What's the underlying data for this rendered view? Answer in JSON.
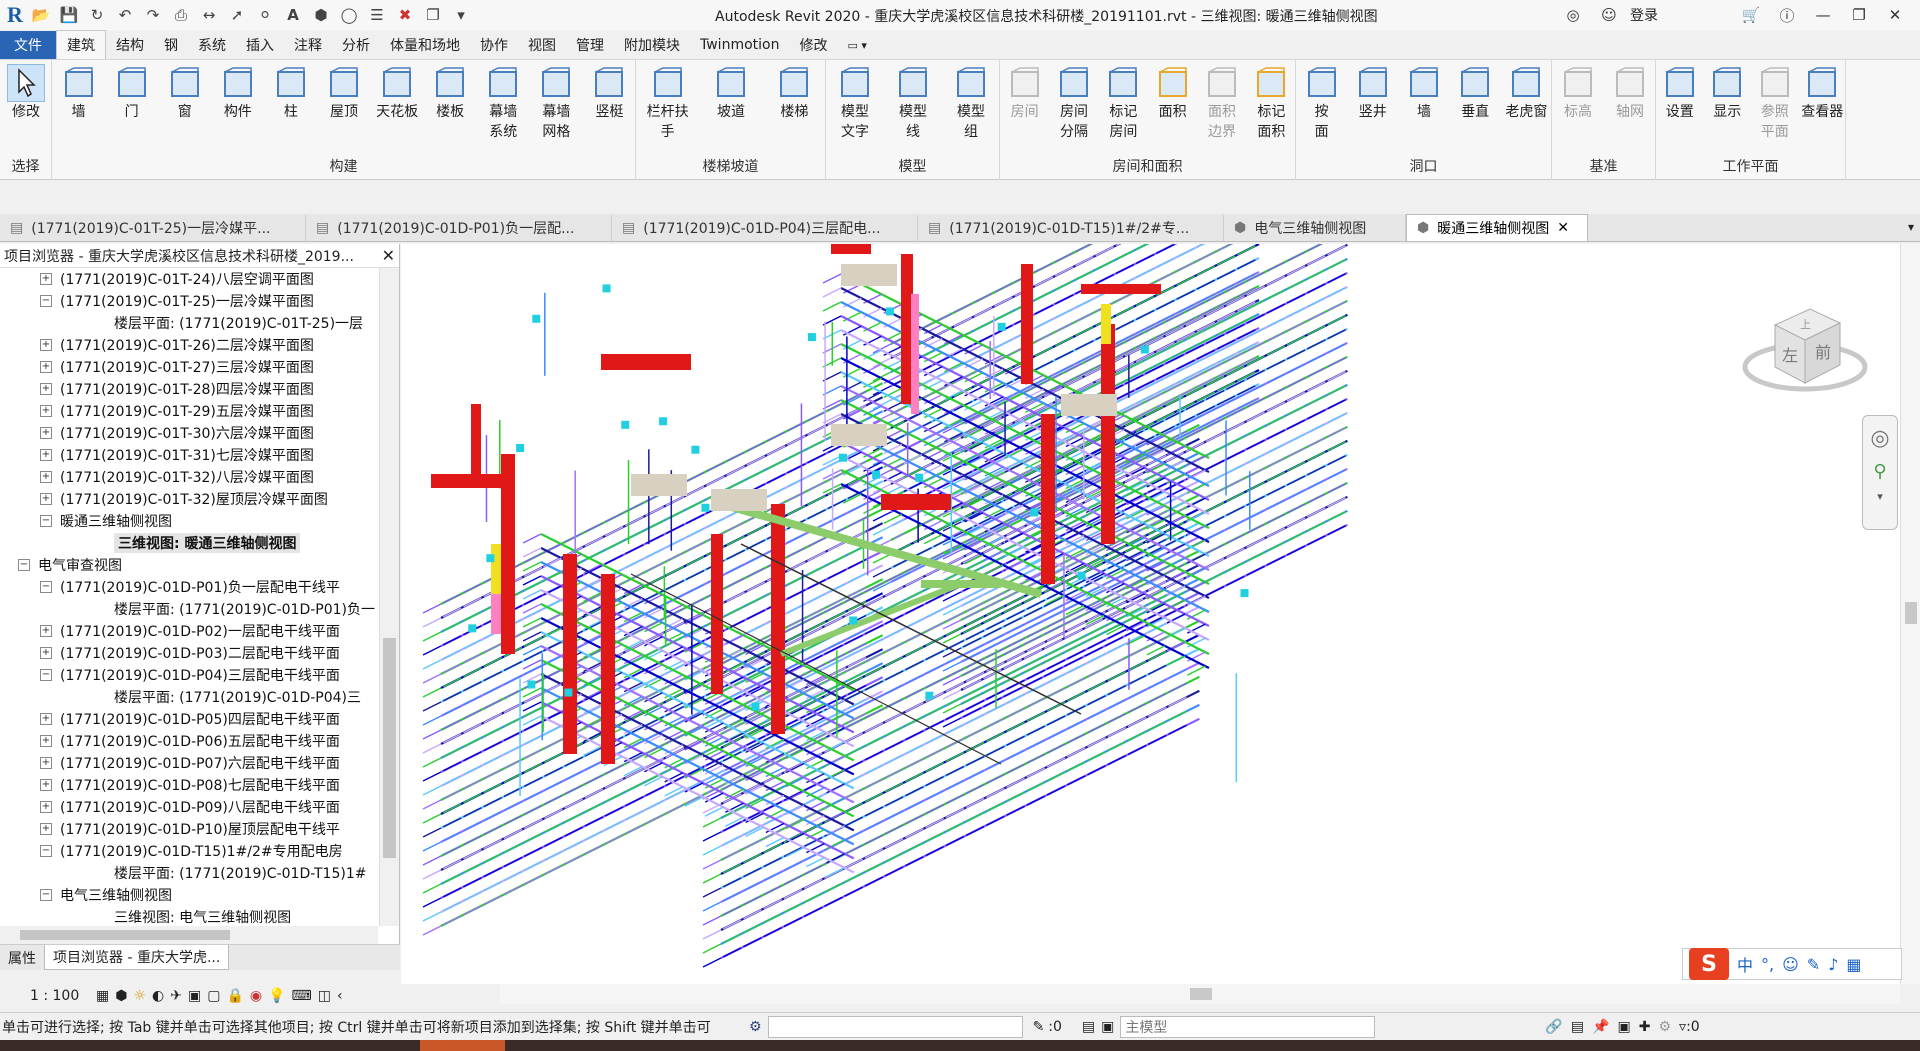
{
  "window": {
    "title": "Autodesk Revit 2020 - 重庆大学虎溪校区信息技术科研楼_20191101.rvt - 三维视图: 暖通三维轴侧视图",
    "login": "登录"
  },
  "menu": {
    "tabs": [
      "文件",
      "建筑",
      "结构",
      "钢",
      "系统",
      "插入",
      "注释",
      "分析",
      "体量和场地",
      "协作",
      "视图",
      "管理",
      "附加模块",
      "Twinmotion",
      "修改"
    ],
    "active_index": 1
  },
  "ribbon": {
    "groups": [
      {
        "title": "选择",
        "buttons": [
          {
            "label": "修改",
            "icon": "modify-arrow-icon"
          }
        ]
      },
      {
        "title": "构建",
        "buttons": [
          {
            "label": "墙",
            "icon": "wall-icon"
          },
          {
            "label": "门",
            "icon": "door-icon"
          },
          {
            "label": "窗",
            "icon": "window-icon"
          },
          {
            "label": "构件",
            "icon": "component-icon"
          },
          {
            "label": "柱",
            "icon": "column-icon"
          },
          {
            "label": "屋顶",
            "icon": "roof-icon"
          },
          {
            "label": "天花板",
            "icon": "ceiling-icon"
          },
          {
            "label": "楼板",
            "icon": "floor-icon"
          },
          {
            "label": "幕墙\n系统",
            "icon": "curtain-system-icon"
          },
          {
            "label": "幕墙\n网格",
            "icon": "curtain-grid-icon"
          },
          {
            "label": "竖梃",
            "icon": "mullion-icon"
          }
        ]
      },
      {
        "title": "楼梯坡道",
        "buttons": [
          {
            "label": "栏杆扶手",
            "icon": "railing-icon"
          },
          {
            "label": "坡道",
            "icon": "ramp-icon"
          },
          {
            "label": "楼梯",
            "icon": "stair-icon"
          }
        ]
      },
      {
        "title": "模型",
        "buttons": [
          {
            "label": "模型\n文字",
            "icon": "model-text-icon"
          },
          {
            "label": "模型\n线",
            "icon": "model-line-icon"
          },
          {
            "label": "模型\n组",
            "icon": "model-group-icon"
          }
        ]
      },
      {
        "title": "房间和面积",
        "buttons": [
          {
            "label": "房间",
            "icon": "room-icon",
            "dim": true
          },
          {
            "label": "房间\n分隔",
            "icon": "room-separator-icon"
          },
          {
            "label": "标记\n房间",
            "icon": "tag-room-icon"
          },
          {
            "label": "面积",
            "icon": "area-icon"
          },
          {
            "label": "面积\n边界",
            "icon": "area-boundary-icon",
            "dim": true
          },
          {
            "label": "标记\n面积",
            "icon": "tag-area-icon"
          }
        ]
      },
      {
        "title": "洞口",
        "buttons": [
          {
            "label": "按\n面",
            "icon": "by-face-icon"
          },
          {
            "label": "竖井",
            "icon": "shaft-icon"
          },
          {
            "label": "墙",
            "icon": "wall-opening-icon"
          },
          {
            "label": "垂直",
            "icon": "vertical-opening-icon"
          },
          {
            "label": "老虎窗",
            "icon": "dormer-icon"
          }
        ]
      },
      {
        "title": "基准",
        "buttons": [
          {
            "label": "标高",
            "icon": "level-icon",
            "dim": true
          },
          {
            "label": "轴网",
            "icon": "grid-icon",
            "dim": true
          }
        ]
      },
      {
        "title": "工作平面",
        "buttons": [
          {
            "label": "设置",
            "icon": "set-workplane-icon"
          },
          {
            "label": "显示",
            "icon": "show-workplane-icon"
          },
          {
            "label": "参照\n平面",
            "icon": "ref-plane-icon",
            "dim": true
          },
          {
            "label": "查看器",
            "icon": "viewer-icon"
          }
        ]
      }
    ]
  },
  "doc_tabs": [
    {
      "label": "(1771(2019)C-01T-25)一层冷媒平..."
    },
    {
      "label": "(1771(2019)C-01D-P01)负一层配..."
    },
    {
      "label": "(1771(2019)C-01D-P04)三层配电..."
    },
    {
      "label": "(1771(2019)C-01D-T15)1#/2#专..."
    },
    {
      "label": "电气三维轴侧视图"
    },
    {
      "label": "暖通三维轴侧视图"
    }
  ],
  "browser": {
    "title": "项目浏览器 - 重庆大学虎溪校区信息技术科研楼_2019...",
    "items": [
      {
        "label": "(1771(2019)C-01T-24)八层空调平面图",
        "level": 2,
        "toggle": "+"
      },
      {
        "label": "(1771(2019)C-01T-25)一层冷媒平面图",
        "level": 2,
        "toggle": "−"
      },
      {
        "label": "楼层平面: (1771(2019)C-01T-25)一层",
        "level": 3,
        "toggle": ""
      },
      {
        "label": "(1771(2019)C-01T-26)二层冷媒平面图",
        "level": 2,
        "toggle": "+"
      },
      {
        "label": "(1771(2019)C-01T-27)三层冷媒平面图",
        "level": 2,
        "toggle": "+"
      },
      {
        "label": "(1771(2019)C-01T-28)四层冷媒平面图",
        "level": 2,
        "toggle": "+"
      },
      {
        "label": "(1771(2019)C-01T-29)五层冷媒平面图",
        "level": 2,
        "toggle": "+"
      },
      {
        "label": "(1771(2019)C-01T-30)六层冷媒平面图",
        "level": 2,
        "toggle": "+"
      },
      {
        "label": "(1771(2019)C-01T-31)七层冷媒平面图",
        "level": 2,
        "toggle": "+"
      },
      {
        "label": "(1771(2019)C-01T-32)八层冷媒平面图",
        "level": 2,
        "toggle": "+"
      },
      {
        "label": "(1771(2019)C-01T-32)屋顶层冷媒平面图",
        "level": 2,
        "toggle": "+"
      },
      {
        "label": "暖通三维轴侧视图",
        "level": 2,
        "toggle": "−"
      },
      {
        "label": "三维视图: 暖通三维轴侧视图",
        "level": 3,
        "toggle": "",
        "selected": true
      },
      {
        "label": "电气审查视图",
        "level": 1,
        "toggle": "−"
      },
      {
        "label": "(1771(2019)C-01D-P01)负一层配电干线平",
        "level": 2,
        "toggle": "−"
      },
      {
        "label": "楼层平面: (1771(2019)C-01D-P01)负一",
        "level": 3,
        "toggle": ""
      },
      {
        "label": "(1771(2019)C-01D-P02)一层配电干线平面",
        "level": 2,
        "toggle": "+"
      },
      {
        "label": "(1771(2019)C-01D-P03)二层配电干线平面",
        "level": 2,
        "toggle": "+"
      },
      {
        "label": "(1771(2019)C-01D-P04)三层配电干线平面",
        "level": 2,
        "toggle": "−"
      },
      {
        "label": "楼层平面: (1771(2019)C-01D-P04)三",
        "level": 3,
        "toggle": ""
      },
      {
        "label": "(1771(2019)C-01D-P05)四层配电干线平面",
        "level": 2,
        "toggle": "+"
      },
      {
        "label": "(1771(2019)C-01D-P06)五层配电干线平面",
        "level": 2,
        "toggle": "+"
      },
      {
        "label": "(1771(2019)C-01D-P07)六层配电干线平面",
        "level": 2,
        "toggle": "+"
      },
      {
        "label": "(1771(2019)C-01D-P08)七层配电干线平面",
        "level": 2,
        "toggle": "+"
      },
      {
        "label": "(1771(2019)C-01D-P09)八层配电干线平面",
        "level": 2,
        "toggle": "+"
      },
      {
        "label": "(1771(2019)C-01D-P10)屋顶层配电干线平",
        "level": 2,
        "toggle": "+"
      },
      {
        "label": "(1771(2019)C-01D-T15)1#/2#专用配电房",
        "level": 2,
        "toggle": "−"
      },
      {
        "label": "楼层平面: (1771(2019)C-01D-T15)1#",
        "level": 3,
        "toggle": ""
      },
      {
        "label": "电气三维轴侧视图",
        "level": 2,
        "toggle": "−"
      },
      {
        "label": "三维视图: 电气三维轴侧视图",
        "level": 3,
        "toggle": ""
      }
    ],
    "bottom_tabs": [
      "属性",
      "项目浏览器 - 重庆大学虎..."
    ]
  },
  "viewcube": {
    "left": "左",
    "front": "前",
    "top": "上"
  },
  "view_control": {
    "scale": "1 : 100"
  },
  "status": {
    "text": "单击可进行选择; 按 Tab 键并单击可选择其他项目; 按 Ctrl 键并单击可将新项目添加到选择集; 按 Shift 键并单击可",
    "zero1": ":0",
    "model": "主模型",
    "filter": ":0"
  },
  "ime": {
    "lang": "中",
    "punct": "°,"
  }
}
